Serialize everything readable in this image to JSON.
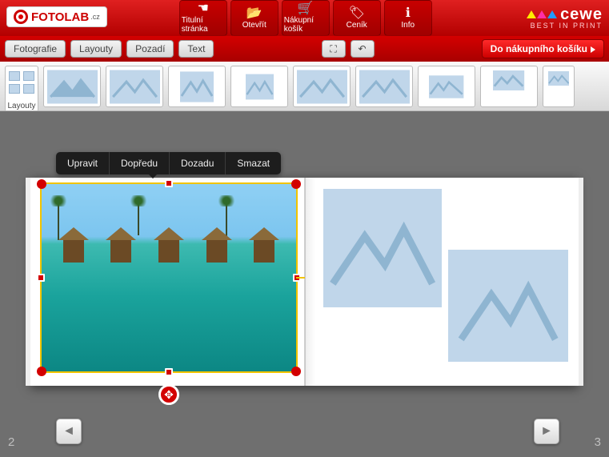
{
  "brand": {
    "logo_main": "FOTOLAB",
    "logo_suffix": ".cz"
  },
  "partner": {
    "name": "cewe",
    "tagline": "BEST IN PRINT"
  },
  "header_buttons": {
    "home": "Titulní stránka",
    "open": "Otevřít",
    "cart": "Nákupní košík",
    "price": "Ceník",
    "info": "Info"
  },
  "toolbar": {
    "photos": "Fotografie",
    "layouts": "Layouty",
    "backgrounds": "Pozadí",
    "text": "Text",
    "fullscreen_icon": "⛶",
    "undo_icon": "↶"
  },
  "cart_button": "Do nákupního košíku",
  "strip_label": "Layouty",
  "context_menu": {
    "edit": "Upravit",
    "forward": "Dopředu",
    "backward": "Dozadu",
    "delete": "Smazat"
  },
  "page_left": "2",
  "page_right": "3"
}
